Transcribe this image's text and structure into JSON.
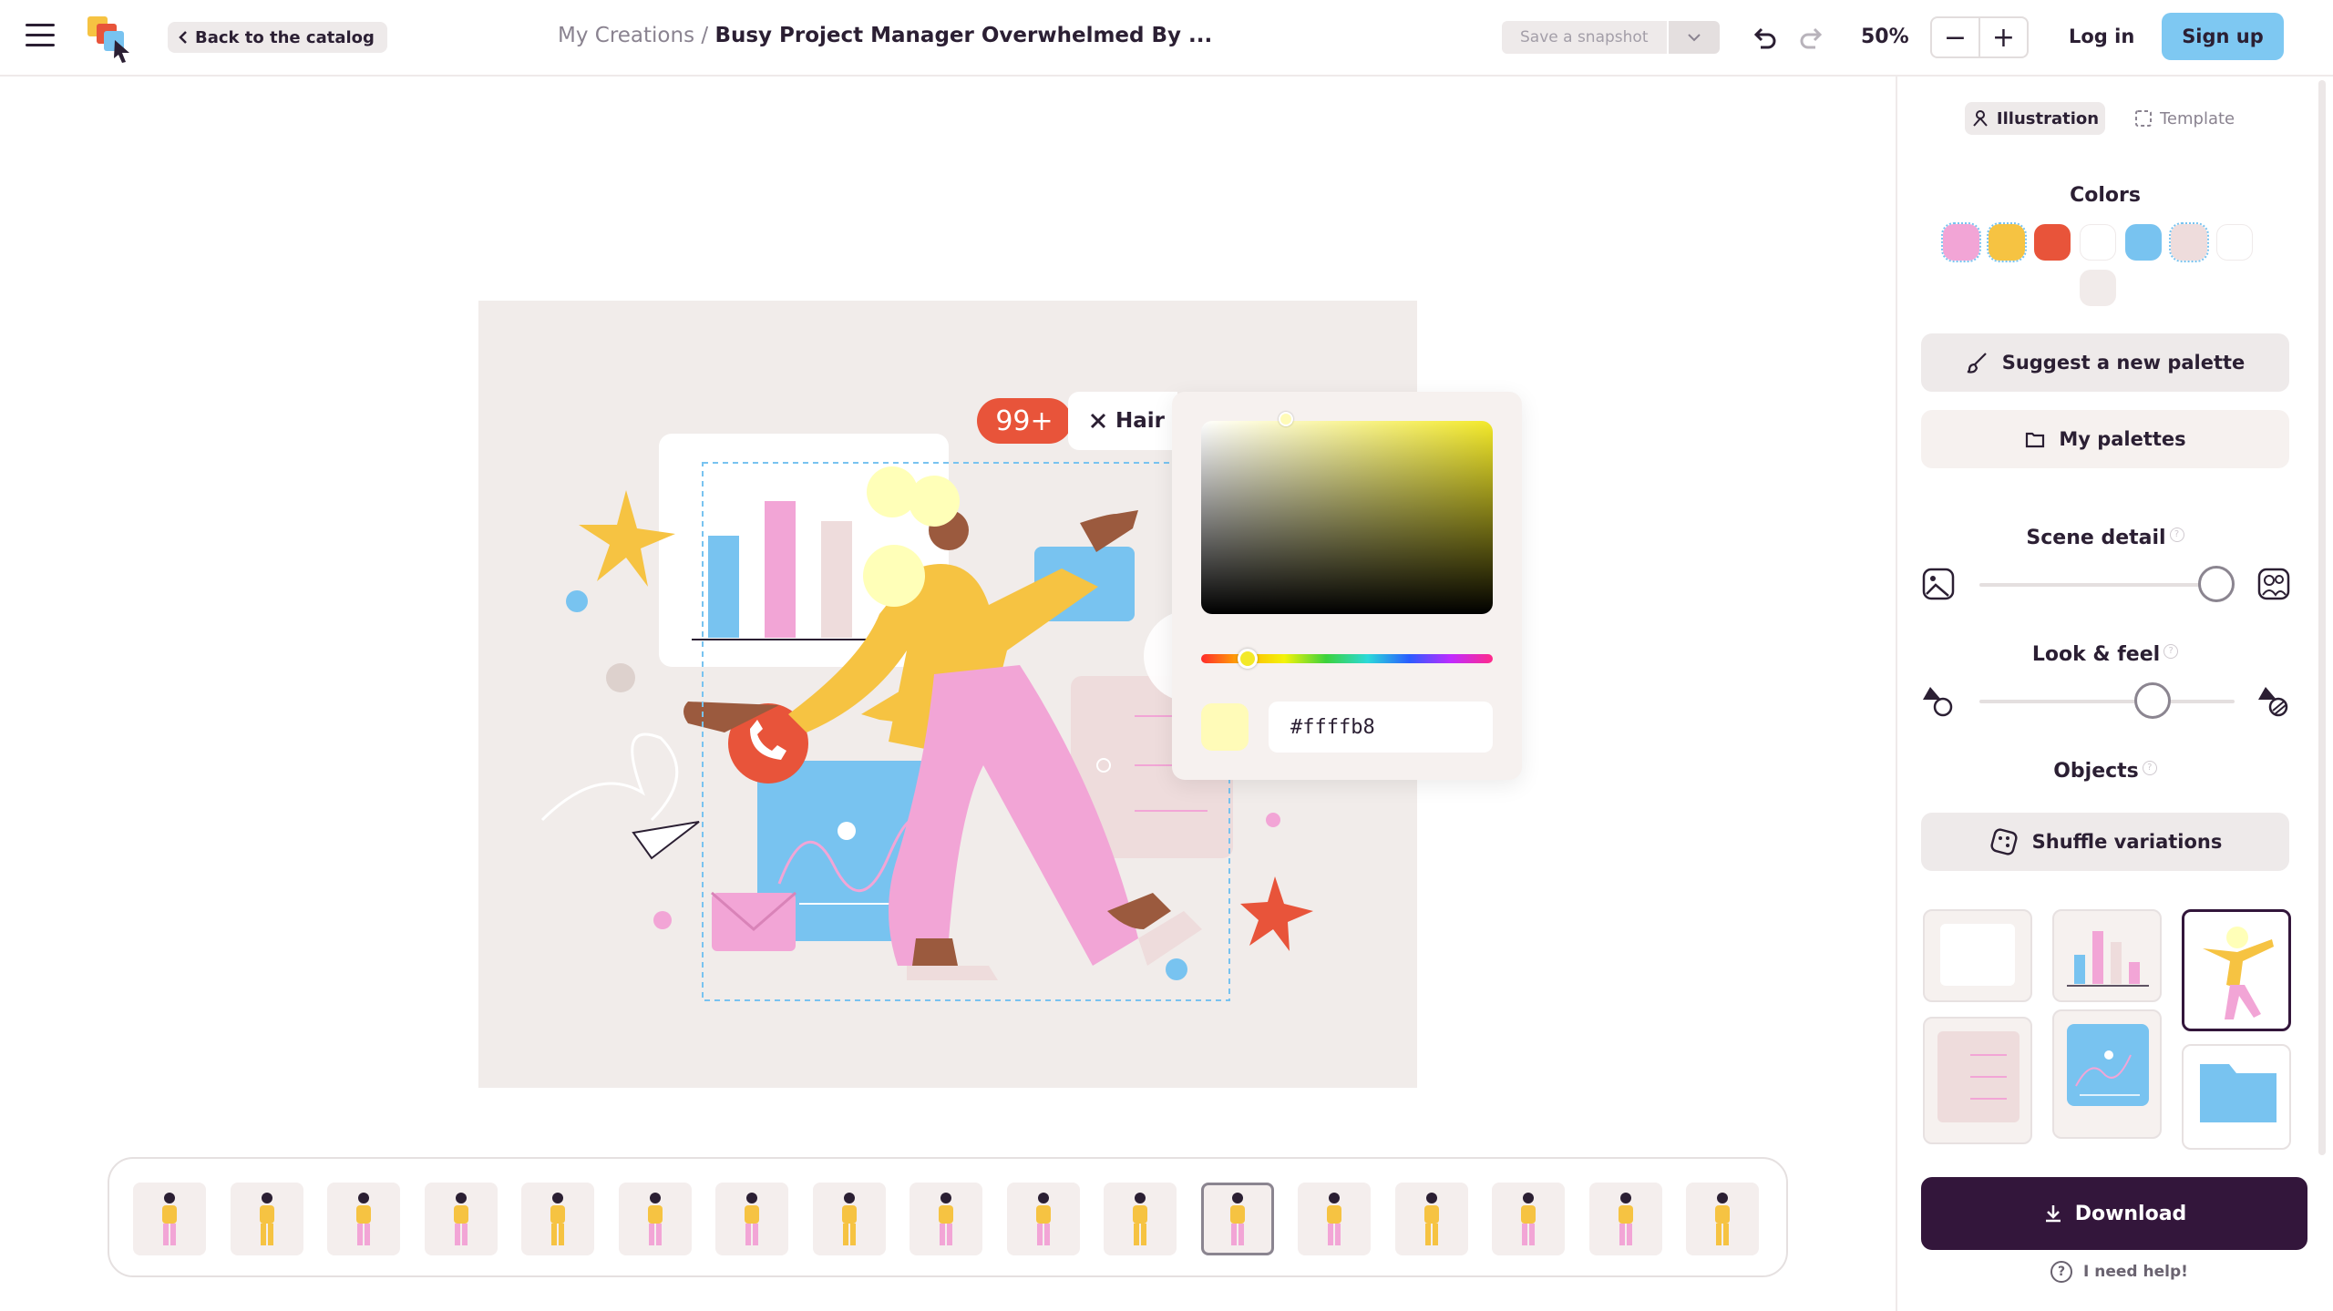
{
  "topbar": {
    "back_label": "Back to the catalog",
    "breadcrumb_parent": "My Creations",
    "breadcrumb_sep": " / ",
    "breadcrumb_title": "Busy Project Manager Overwhelmed By ...",
    "snapshot_label": "Save a snapshot",
    "zoom": "50%",
    "zoom_out": "−",
    "zoom_in": "+",
    "login": "Log in",
    "signup": "Sign up"
  },
  "canvas": {
    "badge": "99+",
    "selected_layer": "Hair",
    "picker": {
      "hex": "#ffffb8",
      "hue": 0.17
    }
  },
  "panel": {
    "tabs": {
      "illustration": "Illustration",
      "template": "Template"
    },
    "colors_title": "Colors",
    "palette": [
      "#f2a5d6",
      "#f6c342",
      "#e8543a",
      "#ffffff",
      "#78c3f0",
      "#eedcdc",
      "#ffffff",
      "#f1ebea"
    ],
    "suggest_palette": "Suggest a new palette",
    "my_palettes": "My palettes",
    "scene_detail_title": "Scene detail",
    "scene_detail_value": 0.93,
    "look_feel_title": "Look & feel",
    "look_feel_value": 0.68,
    "objects_title": "Objects",
    "shuffle": "Shuffle variations",
    "download": "Download",
    "help": "I need help!",
    "help_mark": "?",
    "info_mark": "?"
  },
  "colors": {
    "accent_blue": "#7ec8f2",
    "dark_purple": "#33163b",
    "brand_pink": "#f2a5d6",
    "brand_yellow": "#f6c342",
    "brand_orange": "#e8543a"
  },
  "thumbnails": {
    "count": 17,
    "active_index": 11
  }
}
